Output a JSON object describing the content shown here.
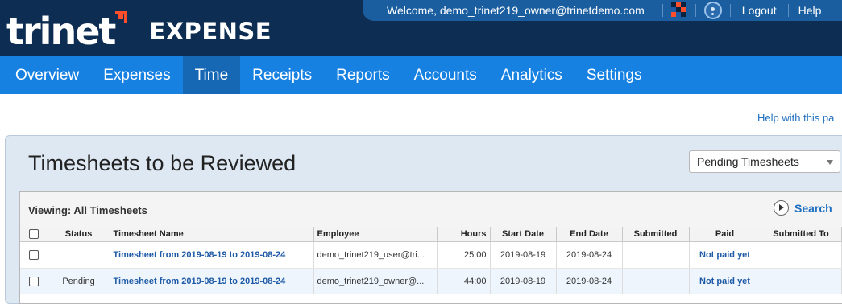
{
  "brand": {
    "logo_text": "trinet",
    "product": "EXPENSE"
  },
  "userbar": {
    "welcome": "Welcome, demo_trinet219_owner@trinetdemo.com",
    "logout": "Logout",
    "help": "Help"
  },
  "nav": {
    "items": [
      "Overview",
      "Expenses",
      "Time",
      "Receipts",
      "Reports",
      "Accounts",
      "Analytics",
      "Settings"
    ],
    "active": "Time"
  },
  "help_link": "Help with this pa",
  "panel": {
    "title": "Timesheets to be Reviewed",
    "filter_value": "Pending Timesheets"
  },
  "grid": {
    "viewing": "Viewing: All Timesheets",
    "search": "Search",
    "columns": [
      "Status",
      "Timesheet Name",
      "Employee",
      "Hours",
      "Start Date",
      "End Date",
      "Submitted",
      "Paid",
      "Submitted To"
    ],
    "rows": [
      {
        "status": "",
        "name": "Timesheet from 2019-08-19 to 2019-08-24",
        "employee": "demo_trinet219_user@tri...",
        "hours": "25:00",
        "start": "2019-08-19",
        "end": "2019-08-24",
        "submitted": "",
        "paid": "Not paid yet",
        "submitted_to": ""
      },
      {
        "status": "Pending",
        "name": "Timesheet from 2019-08-19 to 2019-08-24",
        "employee": "demo_trinet219_owner@...",
        "hours": "44:00",
        "start": "2019-08-19",
        "end": "2019-08-24",
        "submitted": "",
        "paid": "Not paid yet",
        "submitted_to": ""
      }
    ]
  },
  "colors": {
    "header_dark": "#0d2e52",
    "nav_blue": "#1781e2",
    "nav_active": "#1667b4",
    "link_blue": "#1f5aa6",
    "logo_accent": "#ff4e2c"
  },
  "icons": [
    "company-logo-icon",
    "help-circle-icon",
    "play-icon",
    "dropdown-caret-icon"
  ]
}
